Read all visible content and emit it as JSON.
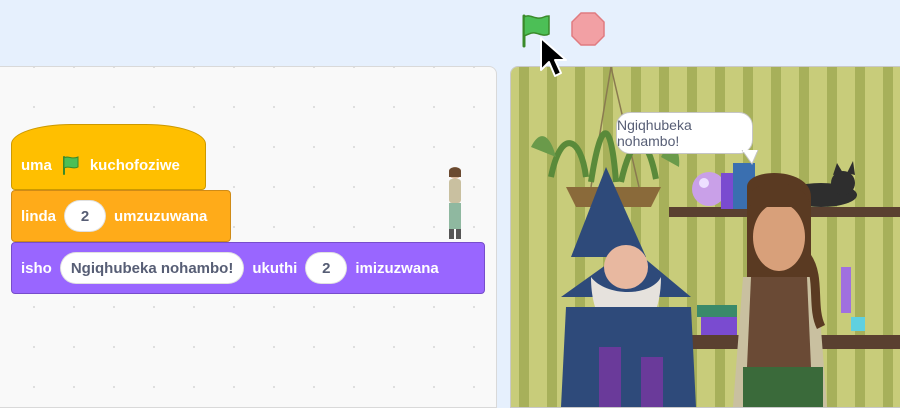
{
  "controls": {
    "green_flag_icon": "green-flag-icon",
    "stop_icon": "stop-icon"
  },
  "colors": {
    "events": "#ffbf00",
    "control": "#ffab19",
    "looks": "#9966ff",
    "stage_wall": "#b8bd6a"
  },
  "blocks": {
    "hat": {
      "prefix": "uma",
      "suffix": "kuchofoziwe"
    },
    "wait": {
      "prefix": "linda",
      "value": "2",
      "suffix": "umzuzuwana"
    },
    "say": {
      "prefix": "isho",
      "message": "Ngiqhubeka nohambo!",
      "middle": "ukuthi",
      "value": "2",
      "suffix": "imizuzwana"
    }
  },
  "stage": {
    "speech_bubble": "Ngiqhubeka nohambo!"
  }
}
